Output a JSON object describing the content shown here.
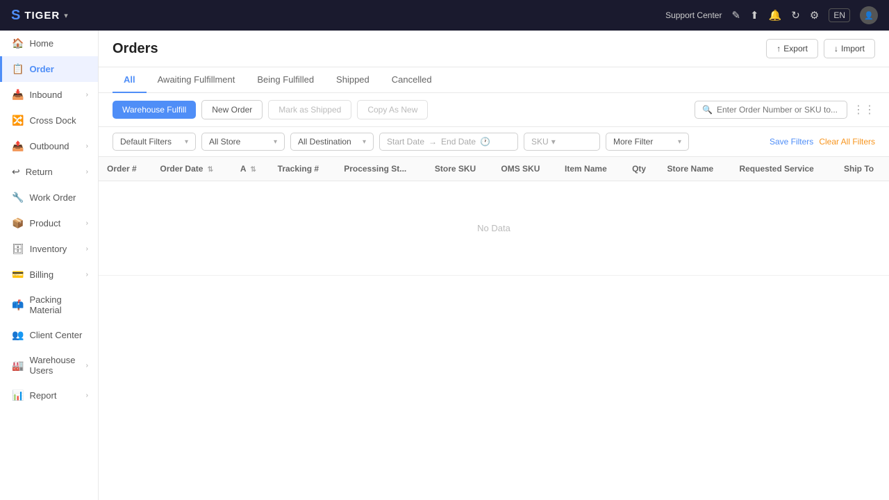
{
  "topnav": {
    "logo": "S",
    "brand": "TIGER",
    "chevron": "▾",
    "support": "Support Center",
    "lang": "EN",
    "icons": [
      "edit-icon",
      "export-icon",
      "bell-icon",
      "refresh-icon",
      "gear-icon"
    ]
  },
  "sidebar": {
    "items": [
      {
        "id": "home",
        "label": "Home",
        "icon": "🏠",
        "active": false,
        "hasChevron": false
      },
      {
        "id": "order",
        "label": "Order",
        "icon": "📋",
        "active": true,
        "hasChevron": false
      },
      {
        "id": "inbound",
        "label": "Inbound",
        "icon": "📥",
        "active": false,
        "hasChevron": true
      },
      {
        "id": "cross-dock",
        "label": "Cross Dock",
        "icon": "🔀",
        "active": false,
        "hasChevron": false
      },
      {
        "id": "outbound",
        "label": "Outbound",
        "icon": "📤",
        "active": false,
        "hasChevron": true
      },
      {
        "id": "return",
        "label": "Return",
        "icon": "↩",
        "active": false,
        "hasChevron": true
      },
      {
        "id": "work-order",
        "label": "Work Order",
        "icon": "🔧",
        "active": false,
        "hasChevron": false
      },
      {
        "id": "product",
        "label": "Product",
        "icon": "📦",
        "active": false,
        "hasChevron": true
      },
      {
        "id": "inventory",
        "label": "Inventory",
        "icon": "🗄",
        "active": false,
        "hasChevron": true
      },
      {
        "id": "billing",
        "label": "Billing",
        "icon": "💳",
        "active": false,
        "hasChevron": true
      },
      {
        "id": "packing-material",
        "label": "Packing Material",
        "icon": "📫",
        "active": false,
        "hasChevron": false
      },
      {
        "id": "client-center",
        "label": "Client Center",
        "icon": "👥",
        "active": false,
        "hasChevron": false
      },
      {
        "id": "warehouse-users",
        "label": "Warehouse Users",
        "icon": "🏭",
        "active": false,
        "hasChevron": true
      },
      {
        "id": "report",
        "label": "Report",
        "icon": "📊",
        "active": false,
        "hasChevron": true
      }
    ]
  },
  "page": {
    "title": "Orders",
    "export_label": "Export",
    "import_label": "Import"
  },
  "tabs": [
    {
      "id": "all",
      "label": "All",
      "active": true
    },
    {
      "id": "awaiting",
      "label": "Awaiting Fulfillment",
      "active": false
    },
    {
      "id": "being-fulfilled",
      "label": "Being Fulfilled",
      "active": false
    },
    {
      "id": "shipped",
      "label": "Shipped",
      "active": false
    },
    {
      "id": "cancelled",
      "label": "Cancelled",
      "active": false
    }
  ],
  "toolbar": {
    "warehouse_fulfill_label": "Warehouse Fulfill",
    "new_order_label": "New Order",
    "mark_shipped_label": "Mark as Shipped",
    "copy_as_label": "Copy As New",
    "search_placeholder": "Enter Order Number or SKU to..."
  },
  "filters": {
    "default_filter_label": "Default Filters",
    "store_label": "All Store",
    "destination_label": "All Destination",
    "start_date_placeholder": "Start Date",
    "end_date_placeholder": "End Date",
    "sku_placeholder": "SKU",
    "more_filter_label": "More Filter",
    "save_filters_label": "Save Filters",
    "clear_all_label": "Clear All Filters"
  },
  "table": {
    "columns": [
      {
        "id": "order-num",
        "label": "Order #",
        "sortable": false
      },
      {
        "id": "order-date",
        "label": "Order Date",
        "sortable": true
      },
      {
        "id": "a",
        "label": "A",
        "sortable": true
      },
      {
        "id": "tracking",
        "label": "Tracking #",
        "sortable": false
      },
      {
        "id": "processing-st",
        "label": "Processing St...",
        "sortable": false
      },
      {
        "id": "store-sku",
        "label": "Store SKU",
        "sortable": false
      },
      {
        "id": "oms-sku",
        "label": "OMS SKU",
        "sortable": false
      },
      {
        "id": "item-name",
        "label": "Item Name",
        "sortable": false
      },
      {
        "id": "qty",
        "label": "Qty",
        "sortable": false
      },
      {
        "id": "store-name",
        "label": "Store Name",
        "sortable": false
      },
      {
        "id": "requested-service",
        "label": "Requested Service",
        "sortable": false
      },
      {
        "id": "ship-to",
        "label": "Ship To",
        "sortable": false
      }
    ],
    "rows": [],
    "no_data_label": "No Data"
  }
}
